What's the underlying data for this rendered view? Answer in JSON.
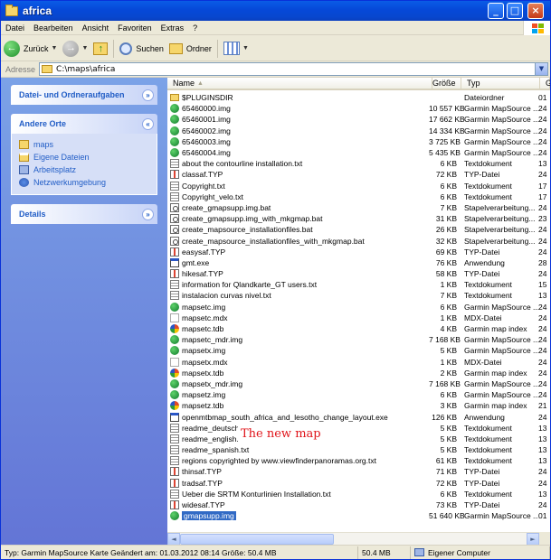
{
  "window": {
    "title": "africa",
    "min": "_",
    "max": "□",
    "close": "×"
  },
  "menu": [
    "Datei",
    "Bearbeiten",
    "Ansicht",
    "Favoriten",
    "Extras",
    "?"
  ],
  "toolbar": {
    "back_label": "Zurück",
    "search_label": "Suchen",
    "folders_label": "Ordner"
  },
  "address": {
    "label": "Adresse",
    "path": "C:\\maps\\africa"
  },
  "sidebar": {
    "file_tasks": "Datei- und Ordneraufgaben",
    "other_places": {
      "title": "Andere Orte",
      "items": [
        "maps",
        "Eigene Dateien",
        "Arbeitsplatz",
        "Netzwerkumgebung"
      ]
    },
    "details": "Details"
  },
  "columns": {
    "name": "Name",
    "size": "Größe",
    "type": "Typ",
    "date": "Ge"
  },
  "files": [
    {
      "name": "$PLUGINSDIR",
      "size": "",
      "type": "Dateiordner",
      "date": "01",
      "icon": "folder"
    },
    {
      "name": "65460000.img",
      "size": "10 557 KB",
      "type": "Garmin MapSource ...",
      "date": "24",
      "icon": "img"
    },
    {
      "name": "65460001.img",
      "size": "17 662 KB",
      "type": "Garmin MapSource ...",
      "date": "24",
      "icon": "img"
    },
    {
      "name": "65460002.img",
      "size": "14 334 KB",
      "type": "Garmin MapSource ...",
      "date": "24",
      "icon": "img"
    },
    {
      "name": "65460003.img",
      "size": "3 725 KB",
      "type": "Garmin MapSource ...",
      "date": "24",
      "icon": "img"
    },
    {
      "name": "65460004.img",
      "size": "5 435 KB",
      "type": "Garmin MapSource ...",
      "date": "24",
      "icon": "img"
    },
    {
      "name": "about the contourline installation.txt",
      "size": "6 KB",
      "type": "Textdokument",
      "date": "13",
      "icon": "txt"
    },
    {
      "name": "classaf.TYP",
      "size": "72 KB",
      "type": "TYP-Datei",
      "date": "24",
      "icon": "typ"
    },
    {
      "name": "Copyright.txt",
      "size": "6 KB",
      "type": "Textdokument",
      "date": "17",
      "icon": "txt"
    },
    {
      "name": "Copyright_velo.txt",
      "size": "6 KB",
      "type": "Textdokument",
      "date": "17",
      "icon": "txt"
    },
    {
      "name": "create_gmapsupp.img.bat",
      "size": "7 KB",
      "type": "Stapelverarbeitung...",
      "date": "24",
      "icon": "bat"
    },
    {
      "name": "create_gmapsupp.img_with_mkgmap.bat",
      "size": "31 KB",
      "type": "Stapelverarbeitung...",
      "date": "23",
      "icon": "bat"
    },
    {
      "name": "create_mapsource_installationfiles.bat",
      "size": "26 KB",
      "type": "Stapelverarbeitung...",
      "date": "24",
      "icon": "bat"
    },
    {
      "name": "create_mapsource_installationfiles_with_mkgmap.bat",
      "size": "32 KB",
      "type": "Stapelverarbeitung...",
      "date": "24",
      "icon": "bat"
    },
    {
      "name": "easysaf.TYP",
      "size": "69 KB",
      "type": "TYP-Datei",
      "date": "24",
      "icon": "typ"
    },
    {
      "name": "gmt.exe",
      "size": "76 KB",
      "type": "Anwendung",
      "date": "28",
      "icon": "exe"
    },
    {
      "name": "hikesaf.TYP",
      "size": "58 KB",
      "type": "TYP-Datei",
      "date": "24",
      "icon": "typ"
    },
    {
      "name": "information for Qlandkarte_GT users.txt",
      "size": "1 KB",
      "type": "Textdokument",
      "date": "15",
      "icon": "txt"
    },
    {
      "name": "instalacion curvas nivel.txt",
      "size": "7 KB",
      "type": "Textdokument",
      "date": "13",
      "icon": "txt"
    },
    {
      "name": "mapsetc.img",
      "size": "6 KB",
      "type": "Garmin MapSource ...",
      "date": "24",
      "icon": "img"
    },
    {
      "name": "mapsetc.mdx",
      "size": "1 KB",
      "type": "MDX-Datei",
      "date": "24",
      "icon": "mdx"
    },
    {
      "name": "mapsetc.tdb",
      "size": "4 KB",
      "type": "Garmin map index",
      "date": "24",
      "icon": "tdb"
    },
    {
      "name": "mapsetc_mdr.img",
      "size": "7 168 KB",
      "type": "Garmin MapSource ...",
      "date": "24",
      "icon": "img"
    },
    {
      "name": "mapsetx.img",
      "size": "5 KB",
      "type": "Garmin MapSource ...",
      "date": "24",
      "icon": "img"
    },
    {
      "name": "mapsetx.mdx",
      "size": "1 KB",
      "type": "MDX-Datei",
      "date": "24",
      "icon": "mdx"
    },
    {
      "name": "mapsetx.tdb",
      "size": "2 KB",
      "type": "Garmin map index",
      "date": "24",
      "icon": "tdb"
    },
    {
      "name": "mapsetx_mdr.img",
      "size": "7 168 KB",
      "type": "Garmin MapSource ...",
      "date": "24",
      "icon": "img"
    },
    {
      "name": "mapsetz.img",
      "size": "6 KB",
      "type": "Garmin MapSource ...",
      "date": "24",
      "icon": "img"
    },
    {
      "name": "mapsetz.tdb",
      "size": "3 KB",
      "type": "Garmin map index",
      "date": "21",
      "icon": "tdb"
    },
    {
      "name": "openmtbmap_south_africa_and_lesotho_change_layout.exe",
      "size": "126 KB",
      "type": "Anwendung",
      "date": "24",
      "icon": "exe"
    },
    {
      "name": "readme_deutsch.txt",
      "size": "5 KB",
      "type": "Textdokument",
      "date": "13",
      "icon": "txt"
    },
    {
      "name": "readme_english.txt",
      "size": "5 KB",
      "type": "Textdokument",
      "date": "13",
      "icon": "txt"
    },
    {
      "name": "readme_spanish.txt",
      "size": "5 KB",
      "type": "Textdokument",
      "date": "13",
      "icon": "txt"
    },
    {
      "name": "regions copyrighted by www.viewfinderpanoramas.org.txt",
      "size": "61 KB",
      "type": "Textdokument",
      "date": "13",
      "icon": "txt"
    },
    {
      "name": "thinsaf.TYP",
      "size": "71 KB",
      "type": "TYP-Datei",
      "date": "24",
      "icon": "typ"
    },
    {
      "name": "tradsaf.TYP",
      "size": "72 KB",
      "type": "TYP-Datei",
      "date": "24",
      "icon": "typ"
    },
    {
      "name": "Ueber die SRTM Konturlinien Installation.txt",
      "size": "6 KB",
      "type": "Textdokument",
      "date": "13",
      "icon": "txt"
    },
    {
      "name": "widesaf.TYP",
      "size": "73 KB",
      "type": "TYP-Datei",
      "date": "24",
      "icon": "typ"
    },
    {
      "name": "gmapsupp.img",
      "size": "51 640 KB",
      "type": "Garmin MapSource ...",
      "date": "01",
      "icon": "img",
      "selected": true
    }
  ],
  "annotation": "The new map",
  "status": {
    "main": "Typ: Garmin MapSource Karte Geändert am: 01.03.2012 08:14 Größe: 50.4 MB",
    "size": "50.4 MB",
    "zone": "Eigener Computer"
  }
}
